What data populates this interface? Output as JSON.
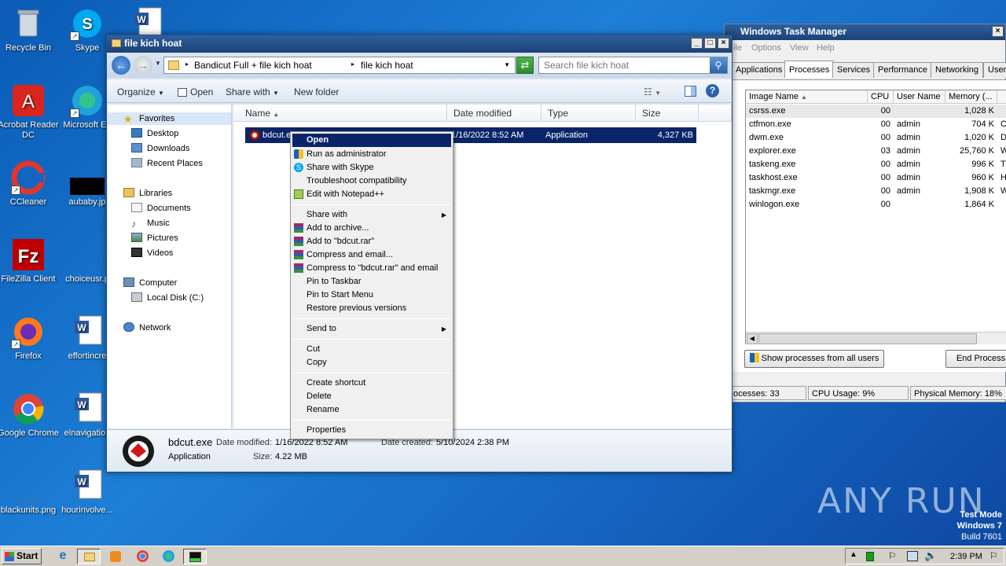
{
  "desktop": {
    "icons": [
      {
        "label": "Recycle Bin"
      },
      {
        "label": "Skype"
      },
      {
        "label": "Acrobat Reader DC"
      },
      {
        "label": "Microsoft Ed"
      },
      {
        "label": "CCleaner"
      },
      {
        "label": "aubaby.jp"
      },
      {
        "label": "FileZilla Client"
      },
      {
        "label": "choiceusr.p"
      },
      {
        "label": "Firefox"
      },
      {
        "label": "effortincre"
      },
      {
        "label": "Google Chrome"
      },
      {
        "label": "elnavigation"
      },
      {
        "label": "blackunits.png"
      },
      {
        "label": "hourinvolve..."
      }
    ],
    "watermark": "ANY RUN",
    "test_mode": {
      "line1": "Test Mode",
      "line2": "Windows 7",
      "line3": "Build 7601"
    }
  },
  "explorer": {
    "title": "file kich hoat",
    "breadcrumb": [
      "Bandicut Full + file kich hoat",
      "file kich hoat"
    ],
    "search_placeholder": "Search file kich hoat",
    "commands": {
      "organize": "Organize",
      "open": "Open",
      "share_with": "Share with",
      "new_folder": "New folder"
    },
    "nav": {
      "favorites": "Favorites",
      "desktop": "Desktop",
      "downloads": "Downloads",
      "recent": "Recent Places",
      "libraries": "Libraries",
      "documents": "Documents",
      "music": "Music",
      "pictures": "Pictures",
      "videos": "Videos",
      "computer": "Computer",
      "local_disk": "Local Disk (C:)",
      "network": "Network"
    },
    "columns": {
      "name": "Name",
      "date": "Date modified",
      "type": "Type",
      "size": "Size"
    },
    "file": {
      "name": "bdcut.e",
      "date": "1/16/2022 8:52 AM",
      "type": "Application",
      "size": "4,327 KB"
    },
    "details": {
      "filename": "bdcut.exe",
      "date_modified_label": "Date modified:",
      "date_modified": "1/16/2022 8:52 AM",
      "date_created_label": "Date created:",
      "date_created": "5/10/2024 2:38 PM",
      "type": "Application",
      "size_label": "Size:",
      "size": "4.22 MB"
    }
  },
  "context_menu": {
    "open": "Open",
    "run_admin": "Run as administrator",
    "share_skype": "Share with Skype",
    "troubleshoot": "Troubleshoot compatibility",
    "notepad": "Edit with Notepad++",
    "share_with": "Share with",
    "add_archive": "Add to archive...",
    "add_rar": "Add to \"bdcut.rar\"",
    "compress_email": "Compress and email...",
    "compress_rar_email": "Compress to \"bdcut.rar\" and email",
    "pin_taskbar": "Pin to Taskbar",
    "pin_start": "Pin to Start Menu",
    "restore": "Restore previous versions",
    "send_to": "Send to",
    "cut": "Cut",
    "copy": "Copy",
    "create_shortcut": "Create shortcut",
    "delete": "Delete",
    "rename": "Rename",
    "properties": "Properties"
  },
  "task_manager": {
    "title": "Windows Task Manager",
    "menu": [
      "ile",
      "Options",
      "View",
      "Help"
    ],
    "tabs": [
      "Applications",
      "Processes",
      "Services",
      "Performance",
      "Networking",
      "Users"
    ],
    "columns": {
      "image": "Image Name",
      "cpu": "CPU",
      "user": "User Name",
      "memory": "Memory (..."
    },
    "rows": [
      {
        "image": "csrss.exe",
        "cpu": "00",
        "user": "",
        "memory": "1,028 K",
        "extra": ""
      },
      {
        "image": "ctfmon.exe",
        "cpu": "00",
        "user": "admin",
        "memory": "704 K",
        "extra": "C"
      },
      {
        "image": "dwm.exe",
        "cpu": "00",
        "user": "admin",
        "memory": "1,020 K",
        "extra": "D"
      },
      {
        "image": "explorer.exe",
        "cpu": "03",
        "user": "admin",
        "memory": "25,760 K",
        "extra": "W"
      },
      {
        "image": "taskeng.exe",
        "cpu": "00",
        "user": "admin",
        "memory": "996 K",
        "extra": "T"
      },
      {
        "image": "taskhost.exe",
        "cpu": "00",
        "user": "admin",
        "memory": "960 K",
        "extra": "H"
      },
      {
        "image": "taskmgr.exe",
        "cpu": "00",
        "user": "admin",
        "memory": "1,908 K",
        "extra": "W"
      },
      {
        "image": "winlogon.exe",
        "cpu": "00",
        "user": "",
        "memory": "1,864 K",
        "extra": ""
      }
    ],
    "show_all": "Show processes from all users",
    "end_process": "End Process",
    "status": {
      "processes": "ocesses: 33",
      "cpu": "CPU Usage: 9%",
      "memory": "Physical Memory: 18%"
    }
  },
  "taskbar": {
    "start": "Start",
    "clock": "2:39 PM"
  }
}
